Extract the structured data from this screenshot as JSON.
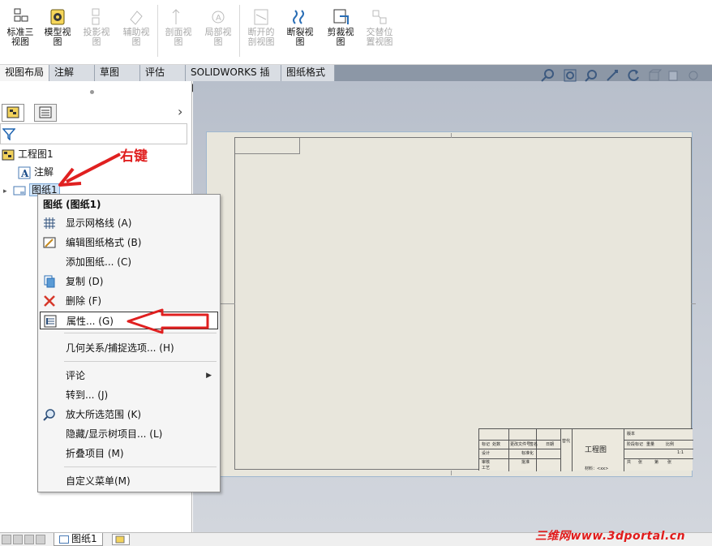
{
  "ribbon": {
    "buttons": [
      {
        "label": "标准三\n视图",
        "icon": "standard-3-view-icon",
        "enabled": true
      },
      {
        "label": "模型视\n图",
        "icon": "model-view-icon",
        "enabled": true
      },
      {
        "label": "投影视\n图",
        "icon": "projected-view-icon",
        "enabled": false
      },
      {
        "label": "辅助视\n图",
        "icon": "auxiliary-view-icon",
        "enabled": false
      },
      {
        "label": "剖面视\n图",
        "icon": "section-view-icon",
        "enabled": false
      },
      {
        "label": "局部视\n图",
        "icon": "detail-view-icon",
        "enabled": false
      },
      {
        "label": "断开的\n剖视图",
        "icon": "broken-out-section-icon",
        "enabled": false
      },
      {
        "label": "断裂视\n图",
        "icon": "break-view-icon",
        "enabled": true
      },
      {
        "label": "剪裁视\n图",
        "icon": "crop-view-icon",
        "enabled": true
      },
      {
        "label": "交替位\n置视图",
        "icon": "alternate-position-view-icon",
        "enabled": false
      }
    ]
  },
  "tabs": [
    "视图布局",
    "注解",
    "草图",
    "评估",
    "SOLIDWORKS 插件",
    "图纸格式"
  ],
  "tree": {
    "root": "工程图1",
    "annotations": "注解",
    "sheet": "图纸1"
  },
  "annotation": {
    "right_click_label": "右键"
  },
  "context_menu": {
    "header": "图纸 (图纸1)",
    "items": [
      {
        "label": "显示网格线 (A)",
        "icon": "grid-icon"
      },
      {
        "label": "编辑图纸格式 (B)",
        "icon": "edit-sheet-format-icon"
      },
      {
        "label": "添加图纸... (C)",
        "icon": ""
      },
      {
        "label": "复制 (D)",
        "icon": "copy-icon"
      },
      {
        "label": "删除 (F)",
        "icon": "delete-icon"
      },
      {
        "label": "属性... (G)",
        "icon": "properties-icon"
      },
      {
        "label": "几何关系/捕捉选项... (H)",
        "icon": ""
      },
      {
        "label": "评论",
        "icon": ""
      },
      {
        "label": "转到... (J)",
        "icon": ""
      },
      {
        "label": "放大所选范围 (K)",
        "icon": "zoom-to-selection-icon"
      },
      {
        "label": "隐藏/显示树项目... (L)",
        "icon": ""
      },
      {
        "label": "折叠项目 (M)",
        "icon": ""
      },
      {
        "label": "自定义菜单(M)",
        "icon": ""
      }
    ]
  },
  "title_block": {
    "title": "工程图",
    "cells": [
      "标记",
      "处数",
      "分区",
      "更改文件号",
      "签名",
      "日期",
      "设计",
      "标准化",
      "审核",
      "工艺",
      "批准",
      "阶段标记",
      "重量",
      "比例",
      "共",
      "张",
      "第",
      "张",
      "1:1",
      "版本",
      "替代"
    ],
    "footer": "材料：<xx>"
  },
  "bottom": {
    "sheet_tab": "图纸1"
  },
  "watermark": "三维网www.3dportal.cn",
  "colors": {
    "annotation_red": "#e02020",
    "tab_bg": "#d9dde3",
    "viewport_bg": "#c2c8d2",
    "sheet_bg": "#e8e6dc"
  }
}
